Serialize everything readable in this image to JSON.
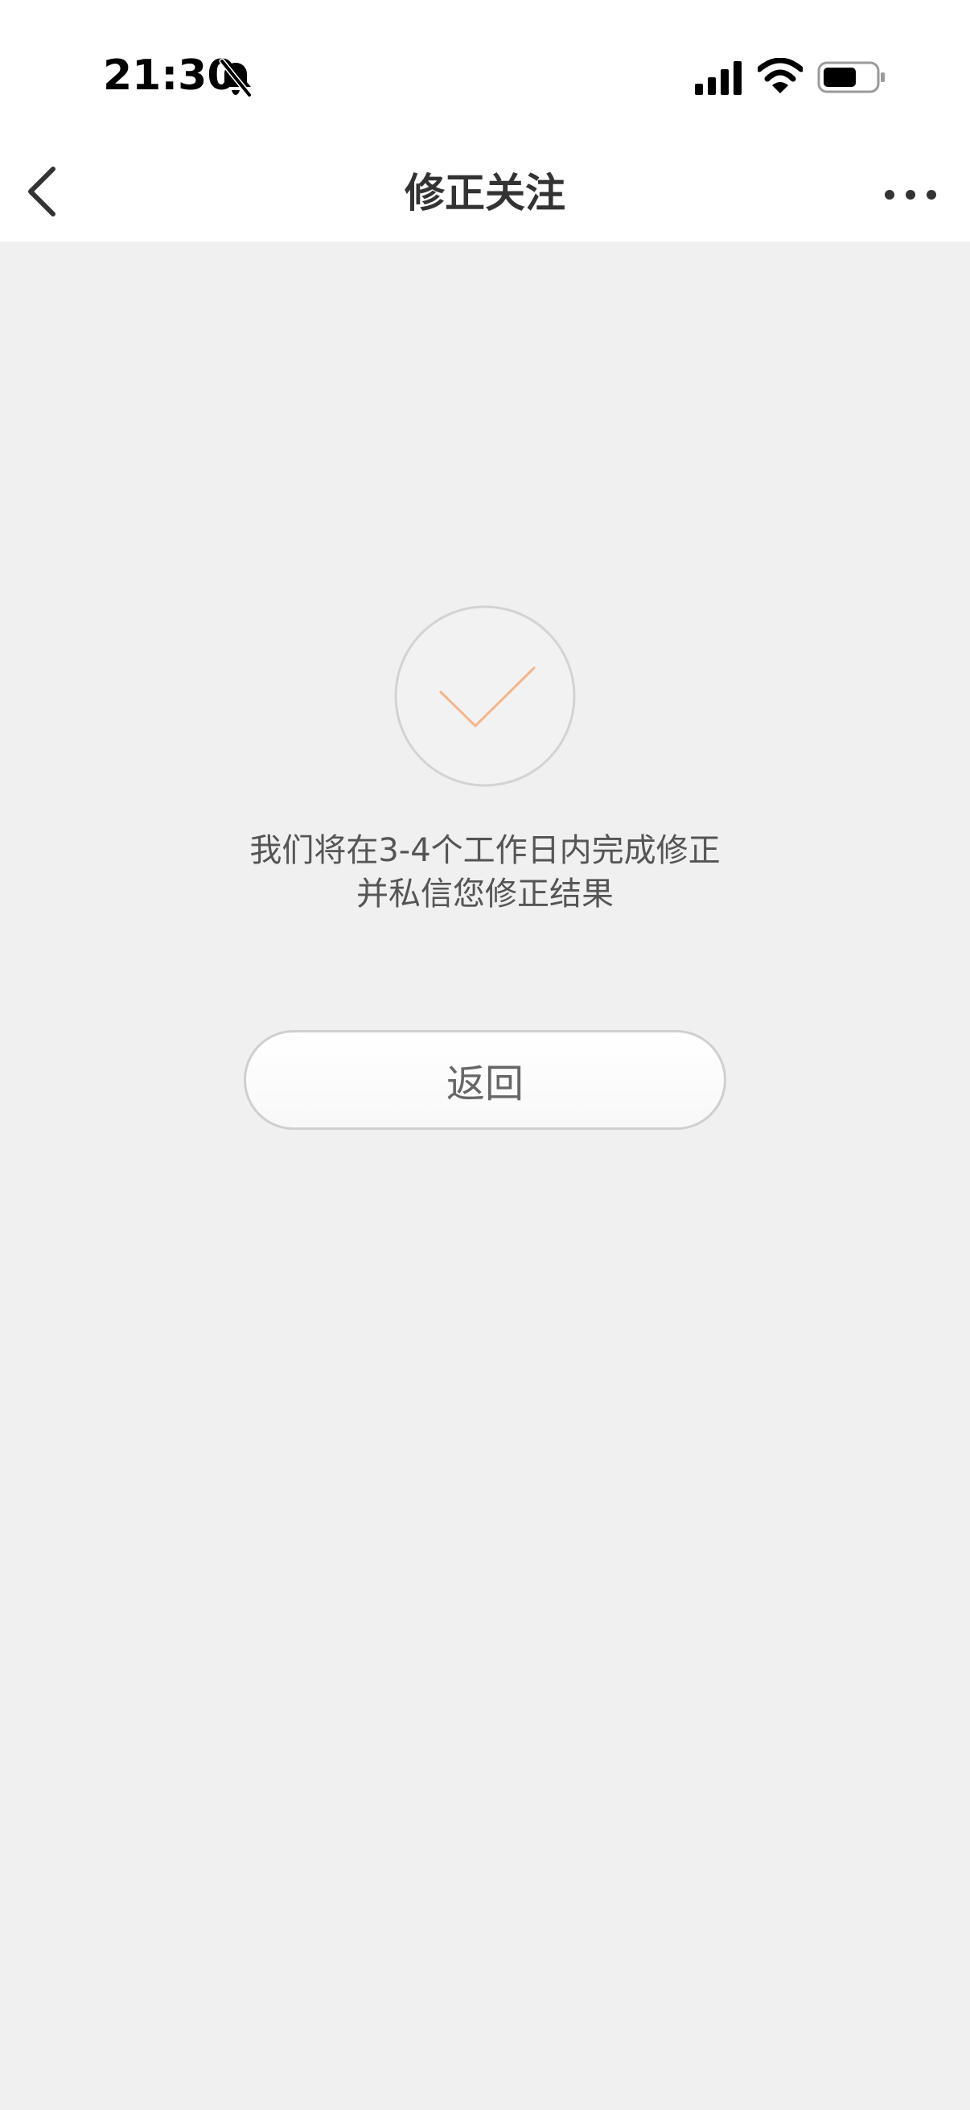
{
  "status_bar": {
    "time": "21:30"
  },
  "nav": {
    "title": "修正关注"
  },
  "content": {
    "message_line1": "我们将在3-4个工作日内完成修正",
    "message_line2": "并私信您修正结果",
    "return_button_label": "返回"
  },
  "colors": {
    "background": "#f0f0f0",
    "header": "#ffffff",
    "check_accent": "#f5b58a",
    "text": "#555555"
  },
  "icons": {
    "status": [
      "bell-muted-icon",
      "signal-icon",
      "wifi-icon",
      "battery-icon"
    ],
    "nav": [
      "chevron-left-icon",
      "more-icon"
    ],
    "content": [
      "checkmark-icon"
    ]
  }
}
